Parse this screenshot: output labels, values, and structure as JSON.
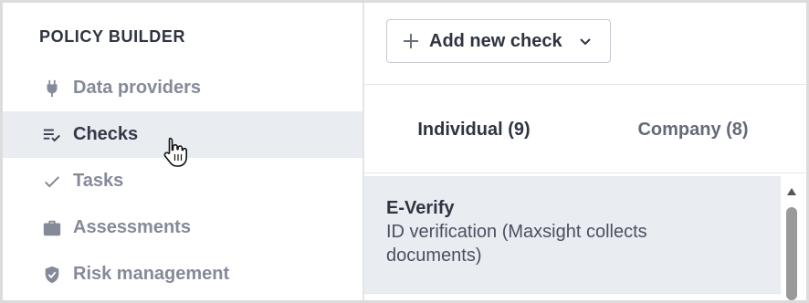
{
  "sidebar": {
    "title": "POLICY BUILDER",
    "items": [
      {
        "label": "Data providers",
        "icon": "plug-icon",
        "active": false
      },
      {
        "label": "Checks",
        "icon": "checklist-icon",
        "active": true
      },
      {
        "label": "Tasks",
        "icon": "check-icon",
        "active": false
      },
      {
        "label": "Assessments",
        "icon": "briefcase-icon",
        "active": false
      },
      {
        "label": "Risk management",
        "icon": "shield-check-icon",
        "active": false
      }
    ]
  },
  "toolbar": {
    "add_button_label": "Add new check",
    "add_icon": "plus-icon",
    "dropdown_icon": "chevron-down-icon"
  },
  "tabs": [
    {
      "label": "Individual (9)",
      "active": true
    },
    {
      "label": "Company (8)",
      "active": false
    }
  ],
  "checks": [
    {
      "title": "E-Verify",
      "subtitle_line1": "ID verification (Maxsight collects",
      "subtitle_line2": "documents)"
    }
  ],
  "colors": {
    "active_bg": "#e9ecf0",
    "text_primary": "#2f3441",
    "text_muted": "#858a99"
  }
}
